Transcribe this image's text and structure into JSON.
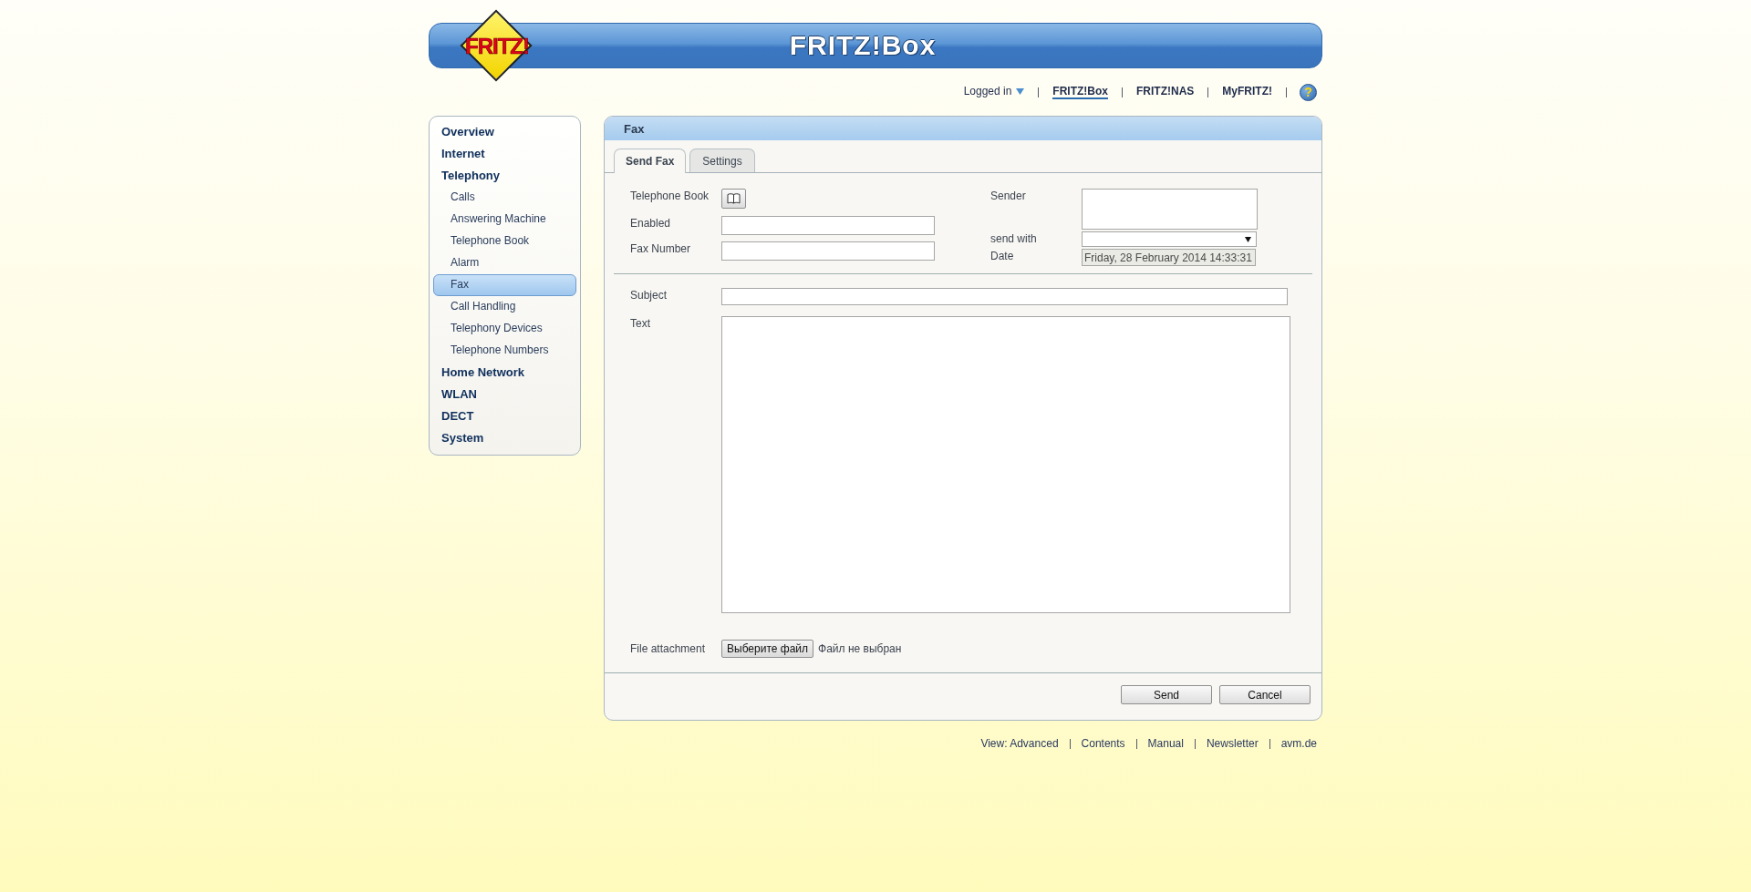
{
  "header": {
    "logo": "FRITZ!",
    "title": "FRITZ!Box"
  },
  "top_nav": {
    "user_menu": "Logged in",
    "links": [
      {
        "label": "FRITZ!Box",
        "selected": true
      },
      {
        "label": "FRITZ!NAS",
        "selected": false
      },
      {
        "label": "MyFRITZ!",
        "selected": false
      }
    ],
    "help": "?"
  },
  "sidebar": {
    "items": [
      {
        "label": "Overview",
        "selected": false
      },
      {
        "label": "Internet",
        "selected": false
      },
      {
        "label": "Telephony",
        "selected": false,
        "children": [
          {
            "label": "Calls",
            "selected": false
          },
          {
            "label": "Answering Machine",
            "selected": false
          },
          {
            "label": "Telephone Book",
            "selected": false
          },
          {
            "label": "Alarm",
            "selected": false
          },
          {
            "label": "Fax",
            "selected": true
          },
          {
            "label": "Call Handling",
            "selected": false
          },
          {
            "label": "Telephony Devices",
            "selected": false
          },
          {
            "label": "Telephone Numbers",
            "selected": false
          }
        ]
      },
      {
        "label": "Home Network",
        "selected": false
      },
      {
        "label": "WLAN",
        "selected": false
      },
      {
        "label": "DECT",
        "selected": false
      },
      {
        "label": "System",
        "selected": false
      }
    ]
  },
  "panel": {
    "title": "Fax",
    "tabs": [
      {
        "label": "Send Fax",
        "selected": true
      },
      {
        "label": "Settings",
        "selected": false
      }
    ],
    "form": {
      "telephone_book": {
        "label": "Telephone Book"
      },
      "enabled": {
        "label": "Enabled"
      },
      "fax_number": {
        "label": "Fax Number"
      },
      "sender": {
        "label": "Sender"
      },
      "send_with": {
        "label": "send with"
      },
      "date": {
        "label": "Date",
        "value": "Friday, 28 February 2014 14:33:31",
        "disabled": true
      },
      "subject": {
        "label": "Subject"
      },
      "text": {
        "label": "Text"
      },
      "file_attachment": {
        "label": "File attachment",
        "button": "Выберите файл",
        "status": "Файл не выбран"
      }
    },
    "buttons": [
      "Send",
      "Cancel"
    ]
  },
  "footer": {
    "links": [
      "View: Advanced",
      "Contents",
      "Manual",
      "Newsletter",
      "avm.de"
    ]
  }
}
